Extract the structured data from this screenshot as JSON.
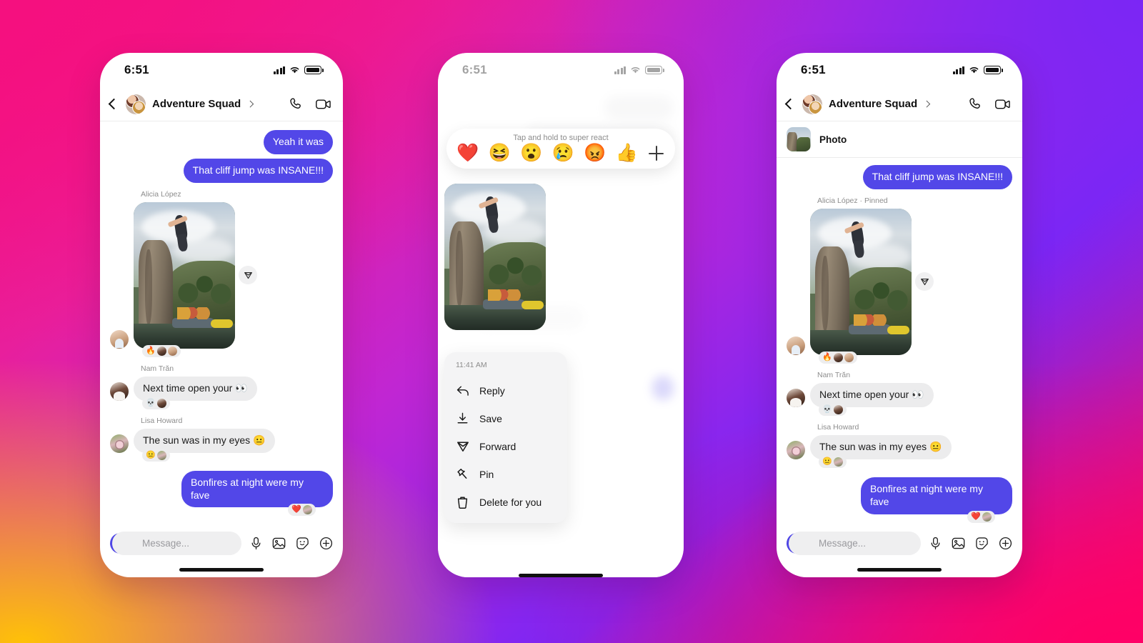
{
  "background": {
    "gradient_colors": [
      "#f5107f",
      "#7b26f5",
      "#ffc107",
      "#ff0066"
    ],
    "description": "instagram-brand-gradient"
  },
  "theme": {
    "outgoing_bubble": "#5247e8",
    "incoming_bubble": "#ececed",
    "accent": "#4f46e5",
    "sender_name_color": "#8d8d8d",
    "menu_background": "#f4f4f5"
  },
  "status_bar": {
    "time": "6:51",
    "icons": [
      "cellular-signal-icon",
      "wifi-icon",
      "battery-icon"
    ]
  },
  "chat_header": {
    "back_label": "Back",
    "title": "Adventure Squad",
    "chevron": "›",
    "call_icon": "phone-call-icon",
    "video_icon": "video-call-icon"
  },
  "composer": {
    "camera_icon": "camera-icon",
    "placeholder": "Message...",
    "icons": [
      "microphone-icon",
      "photo-library-icon",
      "sticker-icon",
      "plus-icon"
    ]
  },
  "phone_1": {
    "label": "default-conversation",
    "messages": [
      {
        "type": "text",
        "side": "out",
        "text": "Yeah it was"
      },
      {
        "type": "text",
        "side": "out",
        "text": "That cliff jump was INSANE!!!"
      },
      {
        "type": "photo",
        "side": "in",
        "sender": "Alicia López",
        "alt": "cliff-jump-photo",
        "forward_icon": "forward-icon",
        "reactions": [
          "🔥",
          "avatar-nam",
          "avatar-alicia"
        ]
      },
      {
        "type": "text",
        "side": "in",
        "sender": "Nam Trăn",
        "text": "Next time open your 👀",
        "reactions": [
          "💀",
          "avatar-nam"
        ]
      },
      {
        "type": "text",
        "side": "in",
        "sender": "Lisa Howard",
        "text": "The sun was in my eyes 😐",
        "reactions": [
          "😐",
          "avatar-lisa"
        ]
      },
      {
        "type": "text",
        "side": "out",
        "text": "Bonfires at night were my fave",
        "reactions": [
          "❤️",
          "avatar-lisa"
        ]
      }
    ]
  },
  "phone_2": {
    "label": "message-long-press-menu",
    "reaction_bar": {
      "hint": "Tap and hold to super react",
      "emojis": [
        "❤️",
        "😆",
        "😮",
        "😢",
        "😡",
        "👍"
      ],
      "add_label": "plus-icon"
    },
    "context_menu": {
      "timestamp": "11:41 AM",
      "items": [
        {
          "icon": "reply-arrow-icon",
          "label": "Reply"
        },
        {
          "icon": "download-icon",
          "label": "Save"
        },
        {
          "icon": "forward-icon",
          "label": "Forward"
        },
        {
          "icon": "pin-icon",
          "label": "Pin"
        },
        {
          "icon": "trash-icon",
          "label": "Delete for you"
        }
      ]
    }
  },
  "phone_3": {
    "label": "conversation-with-pinned-photo",
    "pinned_banner": {
      "thumb": "cliff-jump-thumbnail",
      "label": "Photo"
    },
    "messages": [
      {
        "type": "text",
        "side": "out",
        "text": "That cliff jump was INSANE!!!"
      },
      {
        "type": "photo",
        "side": "in",
        "sender": "Alicia López · Pinned",
        "alt": "cliff-jump-photo",
        "forward_icon": "forward-icon",
        "reactions": [
          "🔥",
          "avatar-nam",
          "avatar-alicia"
        ]
      },
      {
        "type": "text",
        "side": "in",
        "sender": "Nam Trăn",
        "text": "Next time open your 👀",
        "reactions": [
          "💀",
          "avatar-nam"
        ]
      },
      {
        "type": "text",
        "side": "in",
        "sender": "Lisa Howard",
        "text": "The sun was in my eyes 😐",
        "reactions": [
          "😐",
          "avatar-lisa"
        ]
      },
      {
        "type": "text",
        "side": "out",
        "text": "Bonfires at night were my fave",
        "reactions": [
          "❤️",
          "avatar-lisa"
        ]
      }
    ]
  }
}
